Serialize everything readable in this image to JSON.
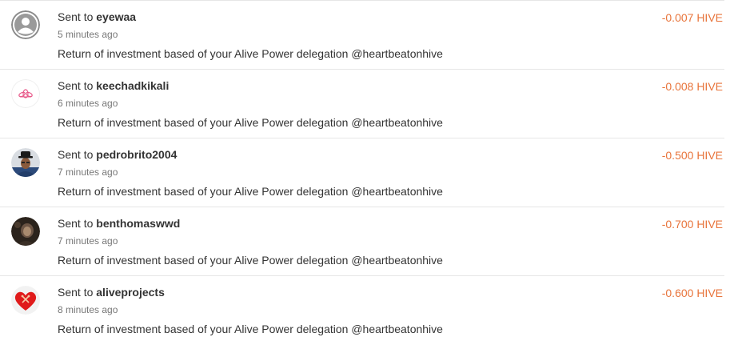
{
  "transfers": [
    {
      "prefix": "Sent to",
      "user": "eyewaa",
      "time": "5 minutes ago",
      "memo": "Return of investment based of your Alive Power delegation @heartbeatonhive",
      "amount": "-0.007 HIVE",
      "avatar": "default-user-icon"
    },
    {
      "prefix": "Sent to",
      "user": "keechadkikali",
      "time": "6 minutes ago",
      "memo": "Return of investment based of your Alive Power delegation @heartbeatonhive",
      "amount": "-0.008 HIVE",
      "avatar": "lotus-icon"
    },
    {
      "prefix": "Sent to",
      "user": "pedrobrito2004",
      "time": "7 minutes ago",
      "memo": "Return of investment based of your Alive Power delegation @heartbeatonhive",
      "amount": "-0.500 HIVE",
      "avatar": "man-with-hat-photo"
    },
    {
      "prefix": "Sent to",
      "user": "benthomaswwd",
      "time": "7 minutes ago",
      "memo": "Return of investment based of your Alive Power delegation @heartbeatonhive",
      "amount": "-0.700 HIVE",
      "avatar": "person-photo"
    },
    {
      "prefix": "Sent to",
      "user": "aliveprojects",
      "time": "8 minutes ago",
      "memo": "Return of investment based of your Alive Power delegation @heartbeatonhive",
      "amount": "-0.600 HIVE",
      "avatar": "red-heart-tools-icon"
    }
  ],
  "colors": {
    "amount": "#e8743b",
    "text": "#333333",
    "muted": "#777777",
    "divider": "#e6e6e6"
  }
}
